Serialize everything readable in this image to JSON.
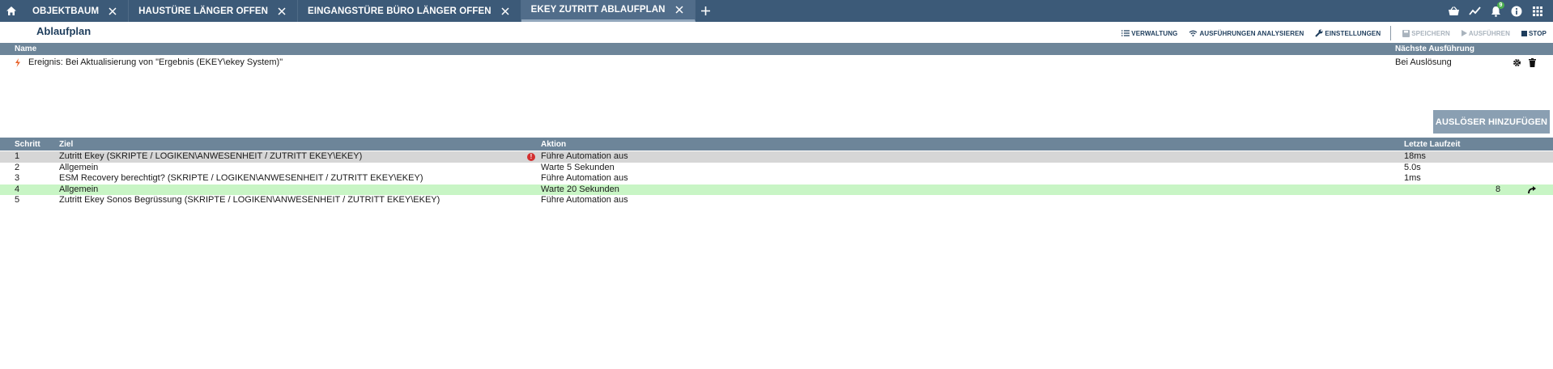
{
  "tabs": [
    {
      "label": "OBJEKTBAUM"
    },
    {
      "label": "HAUSTÜRE LÄNGER OFFEN"
    },
    {
      "label": "EINGANGSTÜRE BÜRO LÄNGER OFFEN"
    },
    {
      "label": "EKEY ZUTRITT ABLAUFPLAN"
    }
  ],
  "notification_count": "9",
  "page_title": "Ablaufplan",
  "toolbar": {
    "verwaltung": "VERWALTUNG",
    "analysieren": "AUSFÜHRUNGEN ANALYSIEREN",
    "einstellungen": "EINSTELLUNGEN",
    "speichern": "SPEICHERN",
    "ausfuehren": "AUSFÜHREN",
    "stop": "STOP"
  },
  "trigger_table": {
    "headers": {
      "name": "Name",
      "next": "Nächste Ausführung"
    },
    "rows": [
      {
        "name": "Ereignis: Bei Aktualisierung von \"Ergebnis (EKEY\\ekey System)\"",
        "next": "Bei Auslösung"
      }
    ]
  },
  "add_trigger_label": "AUSLÖSER HINZUFÜGEN",
  "steps_table": {
    "headers": {
      "step": "Schritt",
      "target": "Ziel",
      "action": "Aktion",
      "last_runtime": "Letzte Laufzeit"
    },
    "rows": [
      {
        "step": "1",
        "target": "Zutritt Ekey (SKRIPTE / LOGIKEN\\ANWESENHEIT / ZUTRITT EKEY\\EKEY)",
        "action": "Führe Automation aus",
        "runtime": "18ms",
        "extra": ""
      },
      {
        "step": "2",
        "target": "Allgemein",
        "action": "Warte 5 Sekunden",
        "runtime": "5.0s",
        "extra": ""
      },
      {
        "step": "3",
        "target": "ESM Recovery berechtigt? (SKRIPTE / LOGIKEN\\ANWESENHEIT / ZUTRITT EKEY\\EKEY)",
        "action": "Führe Automation aus",
        "runtime": "1ms",
        "extra": ""
      },
      {
        "step": "4",
        "target": "Allgemein",
        "action": "Warte 20 Sekunden",
        "runtime": "",
        "extra": "8"
      },
      {
        "step": "5",
        "target": "Zutritt Ekey Sonos Begrüssung (SKRIPTE / LOGIKEN\\ANWESENHEIT / ZUTRITT EKEY\\EKEY)",
        "action": "Führe Automation aus",
        "runtime": "",
        "extra": ""
      }
    ]
  },
  "colors": {
    "topbar": "#3c5a78",
    "header": "#6d8599",
    "selected_row": "#d6d6d6",
    "running_row": "#c8f5c5",
    "error": "#d32f2f"
  }
}
